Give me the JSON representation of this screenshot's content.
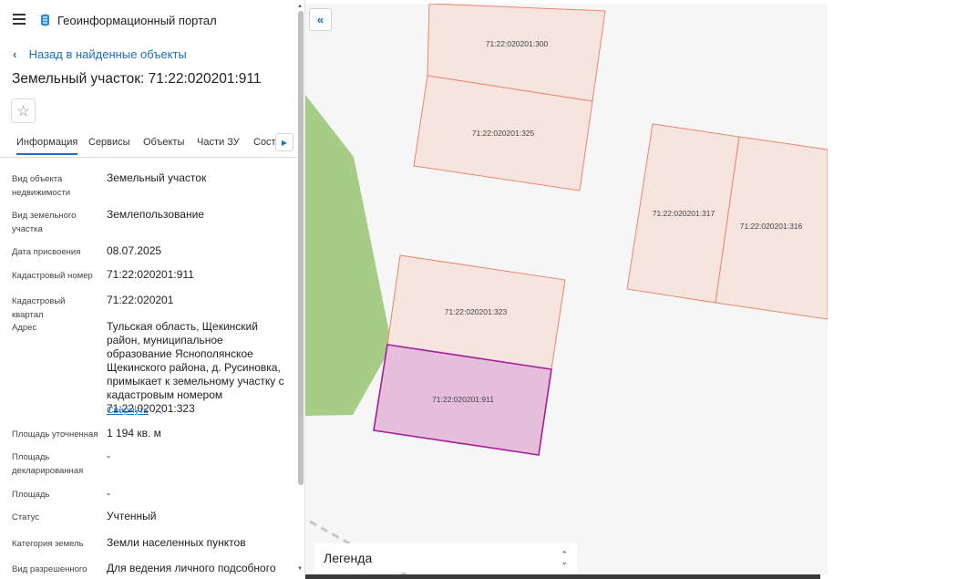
{
  "app": {
    "title": "Геоинформационный портал",
    "menu_icon": "hamburger-icon",
    "logo_icon": "portal-logo-icon"
  },
  "nav": {
    "back_label": "Назад в найденные объекты"
  },
  "object": {
    "title": "Земельный участок: 71:22:020201:911"
  },
  "tabs": [
    {
      "label": "Информация"
    },
    {
      "label": "Сервисы"
    },
    {
      "label": "Объекты"
    },
    {
      "label": "Части ЗУ"
    },
    {
      "label": "Соста"
    }
  ],
  "fields": [
    {
      "label": "Вид объекта недвижимости",
      "value": "Земельный участок"
    },
    {
      "label": "Вид земельного участка",
      "value": "Землепользование"
    },
    {
      "label": "Дата присвоения",
      "value": "08.07.2025"
    },
    {
      "label": "Кадастровый номер",
      "value": "71:22:020201:911"
    },
    {
      "label": "Кадастровый квартал",
      "value": "71:22:020201"
    },
    {
      "label": "Адрес",
      "value": "Тульская область, Щекинский район, муниципальное образование Яснополянское Щекинского района, д. Русиновка, примыкает к земельному участку с кадастровым номером 71:22:020201:323"
    },
    {
      "label": "Площадь уточненная",
      "value": "1 194 кв. м"
    },
    {
      "label": "Площадь декларированная",
      "value": "-"
    },
    {
      "label": "Площадь",
      "value": "-"
    },
    {
      "label": "Статус",
      "value": "Учтенный"
    },
    {
      "label": "Категория земель",
      "value": "Земли населенных пунктов"
    },
    {
      "label": "Вид разрешенного",
      "value": "Для ведения личного подсобного"
    }
  ],
  "collapse_label": "Свернуть",
  "map": {
    "parcels": [
      {
        "label": "71:22:020201:300"
      },
      {
        "label": "71:22:020201:325"
      },
      {
        "label": "71:22:020201:317"
      },
      {
        "label": "71:22:020201:316"
      },
      {
        "label": "71:22:020201:323"
      },
      {
        "label": "71:22:020201:911",
        "selected": true
      }
    ],
    "colors": {
      "parcel_fill": "#f6e4df",
      "parcel_stroke": "#e8876d",
      "selected_fill": "#e5bedb",
      "selected_stroke": "#a21e9a",
      "green_area": "#a6cc85",
      "map_bg": "#f6f6f6"
    },
    "legend_label": "Легенда"
  }
}
